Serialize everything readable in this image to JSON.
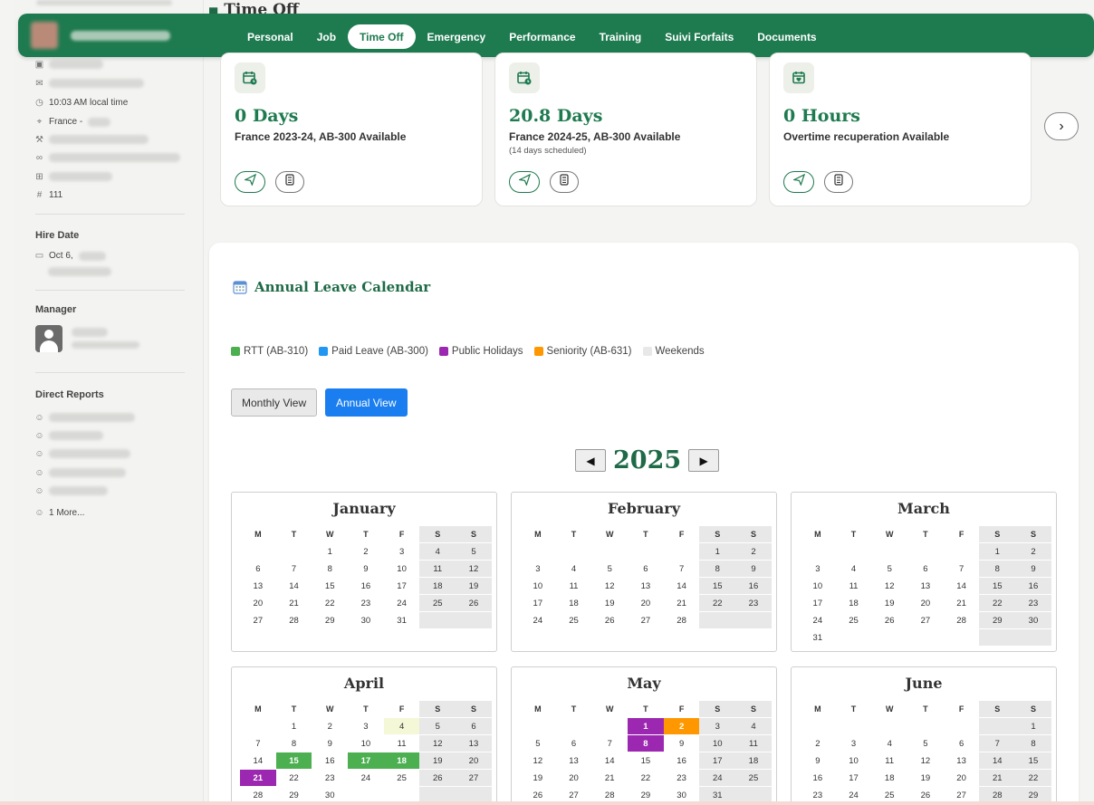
{
  "colors": {
    "brand": "#1e7a4f",
    "rtt": "#4caf50",
    "paid_leave": "#2196f3",
    "holiday": "#9c27b0",
    "seniority": "#ff9800",
    "weekend": "#e8e8e8"
  },
  "header_partial_title": "Time Off",
  "tabs": [
    {
      "label": "Personal",
      "active": false
    },
    {
      "label": "Job",
      "active": false
    },
    {
      "label": "Time Off",
      "active": true
    },
    {
      "label": "Emergency",
      "active": false
    },
    {
      "label": "Performance",
      "active": false
    },
    {
      "label": "Training",
      "active": false
    },
    {
      "label": "Suivi Forfaits",
      "active": false
    },
    {
      "label": "Documents",
      "active": false
    }
  ],
  "sidebar": {
    "local_time": "10:03 AM local time",
    "location": "France - ",
    "employee_number": "111",
    "hire_date_title": "Hire Date",
    "hire_date": "Oct 6,",
    "manager_title": "Manager",
    "direct_reports_title": "Direct Reports",
    "more_reports": "1 More..."
  },
  "cards": [
    {
      "icon": "calendar-clock-icon",
      "amount": "0 Days",
      "description": "France 2023-24, AB-300 Available",
      "sub": ""
    },
    {
      "icon": "calendar-clock-icon",
      "amount": "20.8 Days",
      "description": "France 2024-25, AB-300 Available",
      "sub": "(14 days scheduled)"
    },
    {
      "icon": "calendar-heart-icon",
      "amount": "0 Hours",
      "description": "Overtime recuperation Available",
      "sub": ""
    }
  ],
  "calendar": {
    "title": "Annual Leave Calendar",
    "legend": [
      {
        "label": "RTT (AB-310)",
        "color": "#4caf50"
      },
      {
        "label": "Paid Leave (AB-300)",
        "color": "#2196f3"
      },
      {
        "label": "Public Holidays",
        "color": "#9c27b0"
      },
      {
        "label": "Seniority (AB-631)",
        "color": "#ff9800"
      },
      {
        "label": "Weekends",
        "color": "#e8e8e8"
      }
    ],
    "monthly_view_label": "Monthly View",
    "annual_view_label": "Annual View",
    "year": "2025",
    "prev_label": "◀",
    "next_label": "▶",
    "weekday_headers": [
      "M",
      "T",
      "W",
      "T",
      "F",
      "S",
      "S"
    ],
    "months": [
      {
        "name": "January",
        "offset": 2,
        "days": 31,
        "events": {}
      },
      {
        "name": "February",
        "offset": 5,
        "days": 28,
        "events": {}
      },
      {
        "name": "March",
        "offset": 5,
        "days": 31,
        "events": {}
      },
      {
        "name": "April",
        "offset": 1,
        "days": 30,
        "events": {
          "4": "pend",
          "15": "rtt",
          "17": "rtt",
          "18": "rtt",
          "21": "hol"
        }
      },
      {
        "name": "May",
        "offset": 3,
        "days": 31,
        "events": {
          "1": "hol",
          "2": "sen",
          "8": "hol"
        }
      },
      {
        "name": "June",
        "offset": 6,
        "days": 30,
        "events": {}
      }
    ]
  }
}
